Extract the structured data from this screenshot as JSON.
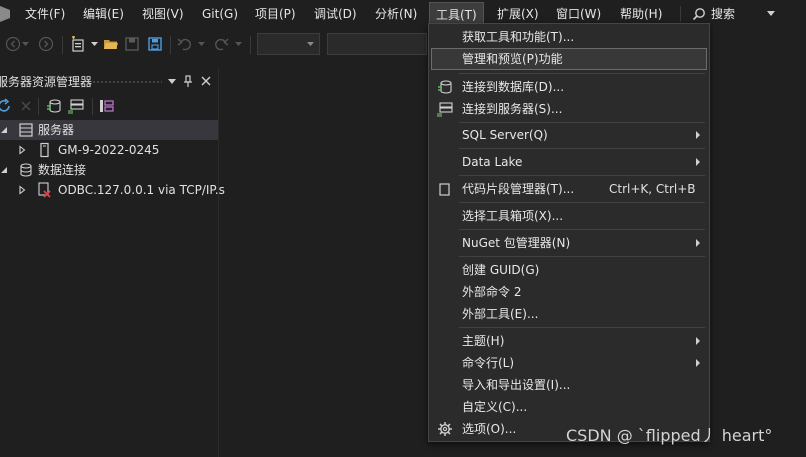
{
  "menubar": {
    "items": [
      "文件(F)",
      "编辑(E)",
      "视图(V)",
      "Git(G)",
      "项目(P)",
      "调试(D)",
      "分析(N)",
      "工具(T)",
      "扩展(X)",
      "窗口(W)",
      "帮助(H)"
    ],
    "search_label": "搜索"
  },
  "panel": {
    "title": "服务器资源管理器",
    "pin": "ᛘ",
    "close": "✕",
    "tree": [
      {
        "label": "服务器",
        "expanded": true,
        "selected": true,
        "icon": "server-icon"
      },
      {
        "label": "GM-9-2022-0245",
        "expanded": false,
        "icon": "computer-icon"
      },
      {
        "label": "数据连接",
        "expanded": true,
        "icon": "data-connections-icon"
      },
      {
        "label": "ODBC.127.0.0.1 via TCP/IP.s",
        "expanded": false,
        "icon": "db-connection-error-icon"
      }
    ]
  },
  "dropdown": {
    "items": [
      {
        "label": "获取工具和功能(T)..."
      },
      {
        "label": "管理和预览(P)功能",
        "highlighted": true
      },
      {
        "label": "连接到数据库(D)...",
        "icon": "connect-database-icon"
      },
      {
        "label": "连接到服务器(S)...",
        "icon": "connect-server-icon"
      },
      {
        "label": "SQL Server(Q)",
        "submenu": true
      },
      {
        "label": "Data Lake",
        "submenu": true
      },
      {
        "label": "代码片段管理器(T)...",
        "shortcut": "Ctrl+K, Ctrl+B",
        "icon": "snippet-icon"
      },
      {
        "label": "选择工具箱项(X)..."
      },
      {
        "label": "NuGet 包管理器(N)",
        "submenu": true
      },
      {
        "label": "创建 GUID(G)"
      },
      {
        "label": "外部命令 2"
      },
      {
        "label": "外部工具(E)..."
      },
      {
        "label": "主题(H)",
        "submenu": true
      },
      {
        "label": "命令行(L)",
        "submenu": true
      },
      {
        "label": "导入和导出设置(I)..."
      },
      {
        "label": "自定义(C)..."
      },
      {
        "label": "选项(O)...",
        "icon": "gear-icon"
      }
    ]
  },
  "watermark": "CSDN @ ˋflipped丿 heart°"
}
